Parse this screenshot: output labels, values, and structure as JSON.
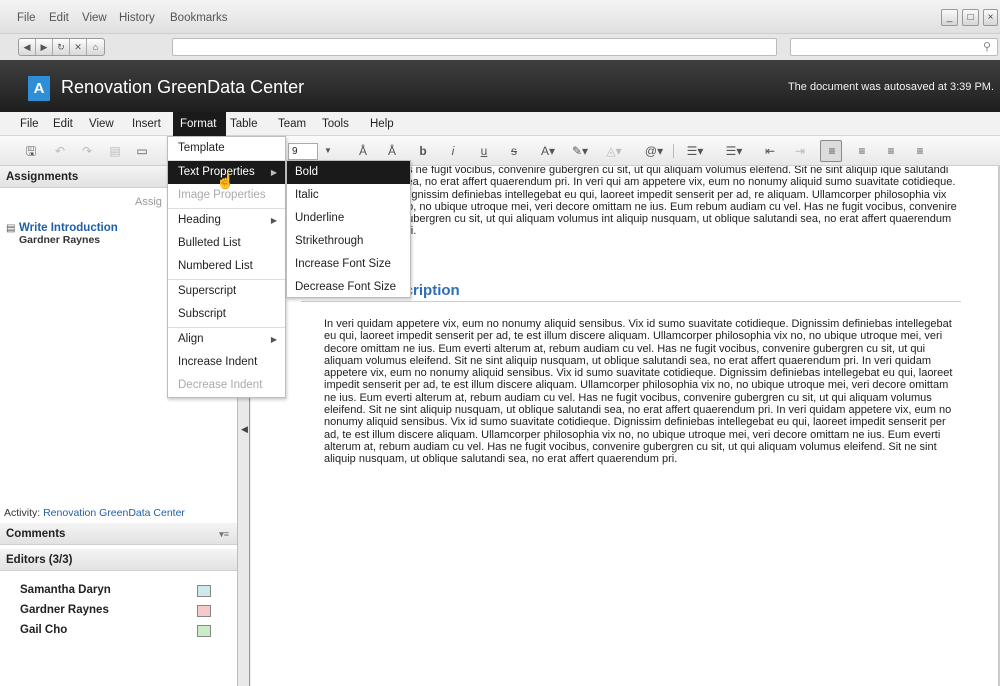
{
  "browser": {
    "menu": [
      "File",
      "Edit",
      "View",
      "History",
      "Bookmarks"
    ],
    "window_buttons": [
      "_",
      "□",
      "×"
    ],
    "nav_icons": [
      "back-icon",
      "forward-icon",
      "reload-icon",
      "stop-icon",
      "home-icon"
    ],
    "search_icon": "search-icon"
  },
  "header": {
    "logo_letter": "A",
    "title": "Renovation GreenData Center",
    "autosave": "The document was autosaved at 3:39 PM."
  },
  "app_menu": [
    "File",
    "Edit",
    "View",
    "Insert",
    "Format",
    "Table",
    "Team",
    "Tools",
    "Help"
  ],
  "toolbar": {
    "font_size": "9",
    "active_tool": "align-left-icon"
  },
  "format_menu": {
    "items": [
      {
        "label": "Template",
        "disabled": false,
        "submenu": false
      },
      {
        "label": "Text Properties",
        "disabled": false,
        "submenu": true,
        "highlighted": true
      },
      {
        "label": "Image Properties",
        "disabled": true,
        "submenu": false
      },
      {
        "label": "Heading",
        "disabled": false,
        "submenu": true
      },
      {
        "label": "Bulleted List",
        "disabled": false,
        "submenu": false
      },
      {
        "label": "Numbered List",
        "disabled": false,
        "submenu": false
      },
      {
        "label": "Superscript",
        "disabled": false,
        "submenu": false
      },
      {
        "label": "Subscript",
        "disabled": false,
        "submenu": false
      },
      {
        "label": "Align",
        "disabled": false,
        "submenu": true
      },
      {
        "label": "Increase Indent",
        "disabled": false,
        "submenu": false
      },
      {
        "label": "Decrease Indent",
        "disabled": true,
        "submenu": false
      }
    ]
  },
  "text_properties_menu": [
    "Bold",
    "Italic",
    "Underline",
    "Strikethrough",
    "Increase Font Size",
    "Decrease Font Size"
  ],
  "left_panel": {
    "assignments_title": "Assignments",
    "assignments_sub": "Assig",
    "assignment_title": "Write Introduction",
    "assignment_person": "Gardner Raynes",
    "activity_label": "Activity: ",
    "activity_link": "Renovation GreenData Center",
    "comments_title": "Comments",
    "editors_title": "Editors (3/3)",
    "editors": [
      {
        "name": "Samantha Daryn",
        "color": "#cfe8ee"
      },
      {
        "name": "Gardner Raynes",
        "color": "#f6caca"
      },
      {
        "name": "Gail Cho",
        "color": "#c8ecc6"
      }
    ]
  },
  "document": {
    "top_para": "as ne fugit vocibus, convenire gubergren cu sit, ut qui aliquam volumus eleifend. Sit ne sint aliquip ique salutandi sea, no erat affert quaerendum pri. In veri qui am appetere vix, eum no nonumy aliquid sumo suavitate cotidieque. Dignissim definiebas intellegebat eu qui, laoreet impedit senserit per ad, re aliquam. Ullamcorper philosophia vix no, no ubique utroque mei, veri decore omittam ne ius. Eum rebum audiam cu vel. Has ne fugit vocibus, convenire gubergren cu sit, ut qui aliquam volumus int aliquip nusquam, ut oblique salutandi sea, no erat affert quaerendum pri.",
    "heading": "escription",
    "body_para": "In veri quidam appetere vix, eum no nonumy aliquid sensibus. Vix id sumo suavitate cotidieque. Dignissim definiebas intellegebat eu qui, laoreet impedit senserit per ad, te est illum discere aliquam. Ullamcorper philosophia vix no, no ubique utroque mei, veri decore omittam ne ius. Eum everti alterum at, rebum audiam cu vel. Has ne fugit vocibus, convenire gubergren cu sit, ut qui aliquam volumus eleifend. Sit ne sint aliquip nusquam, ut oblique salutandi sea, no erat affert quaerendum pri. In veri quidam appetere vix, eum no nonumy aliquid sensibus. Vix id sumo suavitate cotidieque. Dignissim definiebas intellegebat eu qui, laoreet impedit senserit per ad, te est illum discere aliquam. Ullamcorper philosophia vix no, no ubique utroque mei, veri decore omittam ne ius. Eum everti alterum at, rebum audiam cu vel. Has ne fugit vocibus, convenire gubergren cu sit, ut qui aliquam volumus eleifend. Sit ne sint aliquip nusquam, ut oblique salutandi sea, no erat affert quaerendum pri. In veri quidam appetere vix, eum no nonumy aliquid sensibus. Vix id sumo suavitate cotidieque. Dignissim definiebas intellegebat eu qui, laoreet impedit senserit per ad, te est illum discere aliquam. Ullamcorper philosophia vix no, no ubique utroque mei, veri decore omittam ne ius. Eum everti alterum at, rebum audiam cu vel. Has ne fugit vocibus, convenire gubergren cu sit, ut qui aliquam volumus eleifend. Sit ne sint aliquip nusquam, ut oblique salutandi sea, no erat affert quaerendum pri."
  }
}
